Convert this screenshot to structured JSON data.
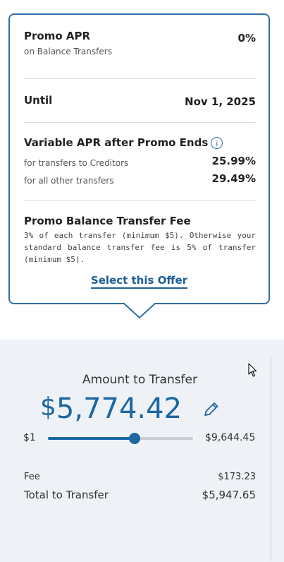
{
  "offer": {
    "promo_apr_label": "Promo APR",
    "promo_apr_sub": "on Balance Transfers",
    "promo_apr_value": "0%",
    "until_label": "Until",
    "until_value": "Nov 1, 2025",
    "variable_label": "Variable APR after Promo Ends",
    "creditors_label": "for transfers to Creditors",
    "creditors_value": "25.99%",
    "other_label": "for all other transfers",
    "other_value": "29.49%",
    "fee_label": "Promo Balance Transfer Fee",
    "fee_desc": "3% of each transfer (minimum $5). Otherwise your standard balance transfer fee is 5% of transfer (minimum $5).",
    "select_label": "Select this Offer"
  },
  "transfer": {
    "title": "Amount to Transfer",
    "currency": "$",
    "amount": "5,774.42",
    "min_label": "$1",
    "max_label": "$9,644.45",
    "slider_fraction": 0.5987,
    "fee_label": "Fee",
    "fee_value": "$173.23",
    "total_label": "Total to Transfer",
    "total_value": "$5,947.65"
  },
  "colors": {
    "accent": "#1b67a3",
    "card_border": "#2f6fa6",
    "panel_bg": "#eef1f5"
  },
  "icons": {
    "info": "info-icon",
    "edit": "pencil-icon",
    "cursor": "mouse-pointer-icon"
  }
}
